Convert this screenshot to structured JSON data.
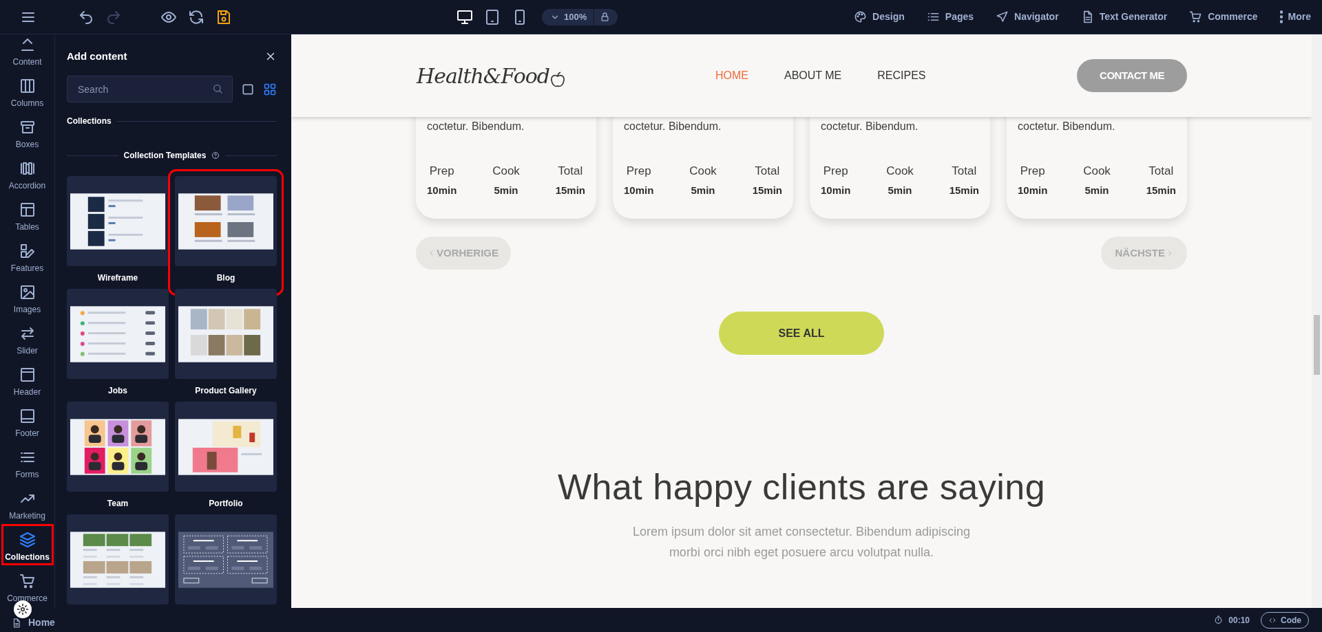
{
  "toolbar": {
    "history": [
      {
        "kind": "undo",
        "disabled": false
      },
      {
        "kind": "redo",
        "disabled": true
      }
    ],
    "actions": [
      {
        "kind": "preview"
      },
      {
        "kind": "refresh"
      },
      {
        "kind": "save",
        "unsaved": true
      }
    ],
    "devices": [
      {
        "kind": "desktop",
        "selected": true
      },
      {
        "kind": "tablet",
        "selected": false
      },
      {
        "kind": "phone",
        "selected": false
      }
    ],
    "zoom": "100%",
    "menu": [
      {
        "label": "Design"
      },
      {
        "label": "Pages"
      },
      {
        "label": "Navigator"
      },
      {
        "label": "Text Generator"
      },
      {
        "label": "Commerce"
      },
      {
        "label": "More"
      }
    ]
  },
  "rail": [
    {
      "label": "Content",
      "selected": false,
      "highlighted": false
    },
    {
      "label": "Columns",
      "selected": false,
      "highlighted": false
    },
    {
      "label": "Boxes",
      "selected": false,
      "highlighted": false
    },
    {
      "label": "Accordion",
      "selected": false,
      "highlighted": false
    },
    {
      "label": "Tables",
      "selected": false,
      "highlighted": false
    },
    {
      "label": "Features",
      "selected": false,
      "highlighted": false
    },
    {
      "label": "Images",
      "selected": false,
      "highlighted": false
    },
    {
      "label": "Slider",
      "selected": false,
      "highlighted": false
    },
    {
      "label": "Header",
      "selected": false,
      "highlighted": false
    },
    {
      "label": "Footer",
      "selected": false,
      "highlighted": false
    },
    {
      "label": "Forms",
      "selected": false,
      "highlighted": false
    },
    {
      "label": "Marketing",
      "selected": false,
      "highlighted": false
    },
    {
      "label": "Collections",
      "selected": true,
      "highlighted": true
    },
    {
      "label": "Commerce",
      "selected": false,
      "highlighted": false
    }
  ],
  "panel": {
    "title": "Add content",
    "search": {
      "placeholder": "Search"
    },
    "view_modes": [
      {
        "kind": "single",
        "selected": false
      },
      {
        "kind": "grid",
        "selected": true
      }
    ],
    "section": "Collections",
    "subsection": "Collection Templates",
    "templates": [
      {
        "label": "Wireframe",
        "highlighted": false
      },
      {
        "label": "Blog",
        "highlighted": true
      },
      {
        "label": "Jobs",
        "highlighted": false
      },
      {
        "label": "Product Gallery",
        "highlighted": false
      },
      {
        "label": "Team",
        "highlighted": false
      },
      {
        "label": "Portfolio",
        "highlighted": false
      },
      {
        "highlighted": false
      },
      {
        "highlighted": false
      }
    ]
  },
  "site": {
    "logo": "Health&Food",
    "nav": [
      {
        "label": "HOME",
        "selected": true
      },
      {
        "label": "ABOUT ME",
        "selected": false
      },
      {
        "label": "RECIPES",
        "selected": false
      }
    ],
    "contact": "CONTACT ME",
    "cards": [
      {
        "text": "coctetur. Bibendum.",
        "stats": [
          {
            "label": "Prep",
            "value": "10min"
          },
          {
            "label": "Cook",
            "value": "5min"
          },
          {
            "label": "Total",
            "value": "15min"
          }
        ]
      },
      {
        "text": "coctetur. Bibendum.",
        "stats": [
          {
            "label": "Prep",
            "value": "10min"
          },
          {
            "label": "Cook",
            "value": "5min"
          },
          {
            "label": "Total",
            "value": "15min"
          }
        ]
      },
      {
        "text": "coctetur. Bibendum.",
        "stats": [
          {
            "label": "Prep",
            "value": "10min"
          },
          {
            "label": "Cook",
            "value": "5min"
          },
          {
            "label": "Total",
            "value": "15min"
          }
        ]
      },
      {
        "text": "coctetur. Bibendum.",
        "stats": [
          {
            "label": "Prep",
            "value": "10min"
          },
          {
            "label": "Cook",
            "value": "5min"
          },
          {
            "label": "Total",
            "value": "15min"
          }
        ]
      }
    ],
    "prev": "VORHERIGE",
    "next": "NÄCHSTE",
    "see_all": "SEE ALL",
    "heading": "What happy clients are saying",
    "paragraph": "Lorem ipsum dolor sit amet consectetur. Bibendum adipiscing morbi orci nibh eget posuere arcu volutpat nulla."
  },
  "status_bar": {
    "page": "Home",
    "timer": "00:10",
    "code": "Code"
  }
}
